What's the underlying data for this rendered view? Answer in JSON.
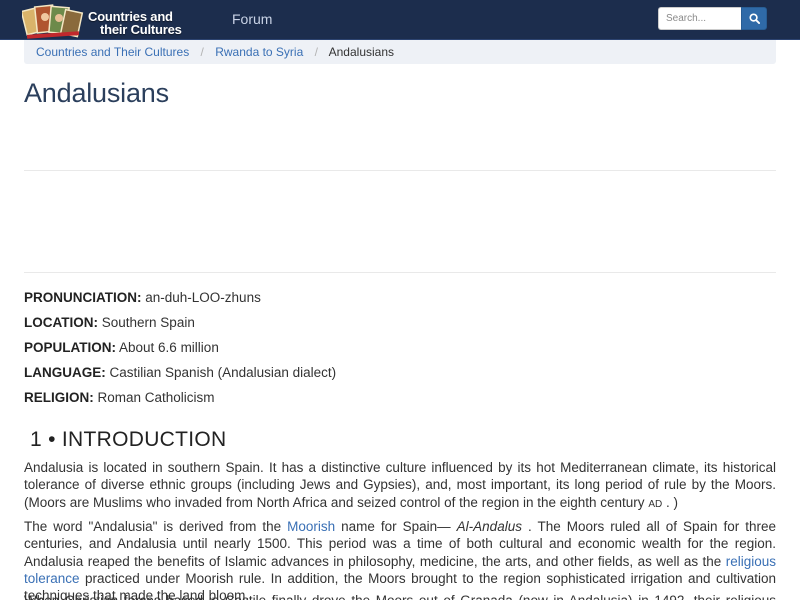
{
  "navbar": {
    "logo_line1": "Countries and",
    "logo_line2": "their Cultures",
    "forum_label": "Forum",
    "search_placeholder": "Search...",
    "colors": {
      "background": "#1c2d4d",
      "search_button": "#2f6aa8"
    }
  },
  "breadcrumb": {
    "items": [
      {
        "label": "Countries and Their Cultures",
        "link": true
      },
      {
        "label": "Rwanda to Syria",
        "link": true
      },
      {
        "label": "Andalusians",
        "link": false
      }
    ],
    "separator": "/"
  },
  "page_title": "Andalusians",
  "facts": [
    {
      "label": "PRONUNCIATION:",
      "value": "an-duh-LOO-zhuns"
    },
    {
      "label": "LOCATION:",
      "value": "Southern Spain"
    },
    {
      "label": "POPULATION:",
      "value": "About 6.6 million"
    },
    {
      "label": "LANGUAGE:",
      "value": "Castilian Spanish (Andalusian dialect)"
    },
    {
      "label": "RELIGION:",
      "value": "Roman Catholicism"
    }
  ],
  "section": {
    "heading": "1 • INTRODUCTION",
    "p1": {
      "text": "Andalusia is located in southern Spain. It has a distinctive culture influenced by its hot Mediterranean climate, its historical tolerance of diverse ethnic groups (including Jews and Gypsies), and, most important, its long period of rule by the Moors. (Moors are Muslims who invaded from North Africa and seized control of the region in the eighth century",
      "era": "AD",
      "end": ". )"
    },
    "p2": {
      "a": "The word \"Andalusia\" is derived from the ",
      "link1": "Moorish",
      "b": " name for Spain— ",
      "italic": "Al-Andalus",
      "c": " . The Moors ruled all of Spain for three centuries, and Andalusia until nearly 1500. This period was a time of both cultural and economic wealth for the region. Andalusia reaped the benefits of Islamic advances in philosophy, medicine, the arts, and other fields, as well as the ",
      "link2": "religious tolerance",
      "d": " practiced under Moorish rule. In addition, the Moors brought to the region sophisticated irrigation and cultivation techniques that made the land bloom."
    },
    "p3": "When Christian forces based in Castile finally drove the Moors out of Granada (now in Andalusia) in 1492, their religious policy"
  }
}
